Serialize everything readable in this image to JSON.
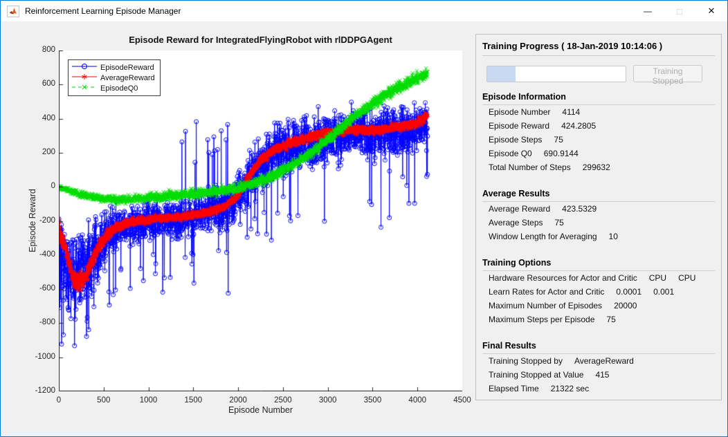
{
  "window": {
    "title": "Reinforcement Learning Episode Manager",
    "controls": {
      "minimize": "—",
      "maximize": "□",
      "close": "✕"
    }
  },
  "panel": {
    "title": "Training Progress ( 18-Jan-2019 10:14:06 )",
    "progress": {
      "percent": 20.6
    },
    "stop_button_label": "Training Stopped",
    "sections": [
      {
        "title": "Episode Information",
        "rows": [
          {
            "label": "Episode Number",
            "values": [
              "4114"
            ]
          },
          {
            "label": "Episode Reward",
            "values": [
              "424.2805"
            ]
          },
          {
            "label": "Episode Steps",
            "values": [
              "75"
            ]
          },
          {
            "label": "Episode Q0",
            "values": [
              "690.9144"
            ]
          },
          {
            "label": "Total Number of Steps",
            "values": [
              "299632"
            ]
          }
        ]
      },
      {
        "title": "Average Results",
        "rows": [
          {
            "label": "Average Reward",
            "values": [
              "423.5329"
            ]
          },
          {
            "label": "Average Steps",
            "values": [
              "75"
            ]
          },
          {
            "label": "Window Length for Averaging",
            "values": [
              "10"
            ]
          }
        ]
      },
      {
        "title": "Training Options",
        "rows": [
          {
            "label": "Hardware Resources for Actor and Critic",
            "values": [
              "CPU",
              "CPU"
            ]
          },
          {
            "label": "Learn Rates for Actor and Critic",
            "values": [
              "0.0001",
              "0.001"
            ]
          },
          {
            "label": "Maximum Number of Episodes",
            "values": [
              "20000"
            ]
          },
          {
            "label": "Maximum Steps per Episode",
            "values": [
              "75"
            ]
          }
        ]
      },
      {
        "title": "Final Results",
        "rows": [
          {
            "label": "Training Stopped by",
            "values": [
              "AverageReward"
            ]
          },
          {
            "label": "Training Stopped at Value",
            "values": [
              "415"
            ]
          },
          {
            "label": "Elapsed Time",
            "values": [
              "21322 sec"
            ]
          }
        ]
      }
    ]
  },
  "chart_data": {
    "type": "line",
    "title": "Episode Reward for IntegratedFlyingRobot with rlDDPGAgent",
    "xlabel": "Episode Number",
    "ylabel": "Episode Reward",
    "xlim": [
      0,
      4500
    ],
    "ylim": [
      -1200,
      800
    ],
    "x_ticks": [
      0,
      500,
      1000,
      1500,
      2000,
      2500,
      3000,
      3500,
      4000,
      4500
    ],
    "y_ticks": [
      800,
      600,
      400,
      200,
      0,
      -200,
      -400,
      -600,
      -800,
      -1000,
      -1200
    ],
    "grid": false,
    "legend_position": "top-left",
    "episodes_plotted": 4114,
    "series": [
      {
        "name": "EpisodeReward",
        "color": "#0000ff",
        "marker": "circle",
        "line": "solid",
        "trend": [
          [
            0,
            -300
          ],
          [
            60,
            -420
          ],
          [
            120,
            -480
          ],
          [
            200,
            -520
          ],
          [
            300,
            -470
          ],
          [
            400,
            -380
          ],
          [
            500,
            -300
          ],
          [
            600,
            -250
          ],
          [
            750,
            -230
          ],
          [
            900,
            -210
          ],
          [
            1100,
            -190
          ],
          [
            1300,
            -185
          ],
          [
            1500,
            -170
          ],
          [
            1700,
            -150
          ],
          [
            1850,
            -120
          ],
          [
            1950,
            -80
          ],
          [
            2050,
            -10
          ],
          [
            2150,
            70
          ],
          [
            2250,
            140
          ],
          [
            2400,
            200
          ],
          [
            2600,
            240
          ],
          [
            2800,
            270
          ],
          [
            3000,
            290
          ],
          [
            3200,
            300
          ],
          [
            3400,
            310
          ],
          [
            3500,
            300
          ],
          [
            3650,
            315
          ],
          [
            3800,
            325
          ],
          [
            3950,
            340
          ],
          [
            4050,
            360
          ],
          [
            4114,
            380
          ]
        ],
        "noise_amp": [
          [
            0,
            330
          ],
          [
            300,
            300
          ],
          [
            500,
            240
          ],
          [
            700,
            160
          ],
          [
            1300,
            150
          ],
          [
            1600,
            170
          ],
          [
            1900,
            190
          ],
          [
            2200,
            210
          ],
          [
            2600,
            220
          ],
          [
            3000,
            210
          ],
          [
            3600,
            200
          ],
          [
            4114,
            190
          ]
        ],
        "spikes": [
          {
            "from": 0,
            "to": 420,
            "p": 0.1,
            "min": 150,
            "max": 480,
            "dir": -1
          },
          {
            "from": 500,
            "to": 2400,
            "p": 0.03,
            "min": 180,
            "max": 420,
            "dir": -1
          },
          {
            "from": 1350,
            "to": 1950,
            "p": 0.045,
            "min": 280,
            "max": 520,
            "dir": 1
          },
          {
            "from": 2400,
            "to": 4114,
            "p": 0.022,
            "min": 250,
            "max": 500,
            "dir": -1
          }
        ],
        "clamp": [
          -1060,
          740
        ]
      },
      {
        "name": "AverageReward",
        "color": "#ff0000",
        "marker": "asterisk",
        "line": "solid",
        "trend": [
          [
            0,
            -240
          ],
          [
            80,
            -380
          ],
          [
            160,
            -540
          ],
          [
            240,
            -560
          ],
          [
            320,
            -500
          ],
          [
            420,
            -380
          ],
          [
            520,
            -290
          ],
          [
            620,
            -240
          ],
          [
            750,
            -215
          ],
          [
            900,
            -200
          ],
          [
            1100,
            -185
          ],
          [
            1300,
            -180
          ],
          [
            1500,
            -165
          ],
          [
            1700,
            -145
          ],
          [
            1850,
            -115
          ],
          [
            1950,
            -75
          ],
          [
            2050,
            -5
          ],
          [
            2150,
            85
          ],
          [
            2250,
            155
          ],
          [
            2400,
            215
          ],
          [
            2600,
            260
          ],
          [
            2800,
            290
          ],
          [
            3000,
            318
          ],
          [
            3200,
            330
          ],
          [
            3350,
            338
          ],
          [
            3500,
            328
          ],
          [
            3650,
            342
          ],
          [
            3800,
            352
          ],
          [
            3950,
            368
          ],
          [
            4050,
            392
          ],
          [
            4114,
            420
          ]
        ],
        "noise_amp": [
          [
            0,
            70
          ],
          [
            300,
            80
          ],
          [
            500,
            60
          ],
          [
            700,
            35
          ],
          [
            1500,
            28
          ],
          [
            2000,
            32
          ],
          [
            2600,
            35
          ],
          [
            4114,
            38
          ]
        ],
        "spikes": [],
        "clamp": [
          -700,
          500
        ]
      },
      {
        "name": "EpisodeQ0",
        "color": "#00dd00",
        "marker": "x",
        "line": "dashed",
        "trend": [
          [
            0,
            0
          ],
          [
            100,
            -20
          ],
          [
            250,
            -45
          ],
          [
            450,
            -65
          ],
          [
            650,
            -75
          ],
          [
            850,
            -72
          ],
          [
            1050,
            -60
          ],
          [
            1250,
            -50
          ],
          [
            1450,
            -42
          ],
          [
            1650,
            -35
          ],
          [
            1850,
            -22
          ],
          [
            2000,
            -8
          ],
          [
            2150,
            15
          ],
          [
            2300,
            45
          ],
          [
            2450,
            85
          ],
          [
            2600,
            125
          ],
          [
            2750,
            175
          ],
          [
            2900,
            235
          ],
          [
            3050,
            300
          ],
          [
            3200,
            370
          ],
          [
            3350,
            435
          ],
          [
            3500,
            490
          ],
          [
            3650,
            540
          ],
          [
            3800,
            585
          ],
          [
            3950,
            625
          ],
          [
            4060,
            650
          ],
          [
            4114,
            662
          ]
        ],
        "noise_amp": [
          [
            0,
            15
          ],
          [
            300,
            32
          ],
          [
            1000,
            38
          ],
          [
            2000,
            42
          ],
          [
            3000,
            46
          ],
          [
            4114,
            50
          ]
        ],
        "spikes": [],
        "clamp": [
          -200,
          735
        ]
      }
    ]
  }
}
